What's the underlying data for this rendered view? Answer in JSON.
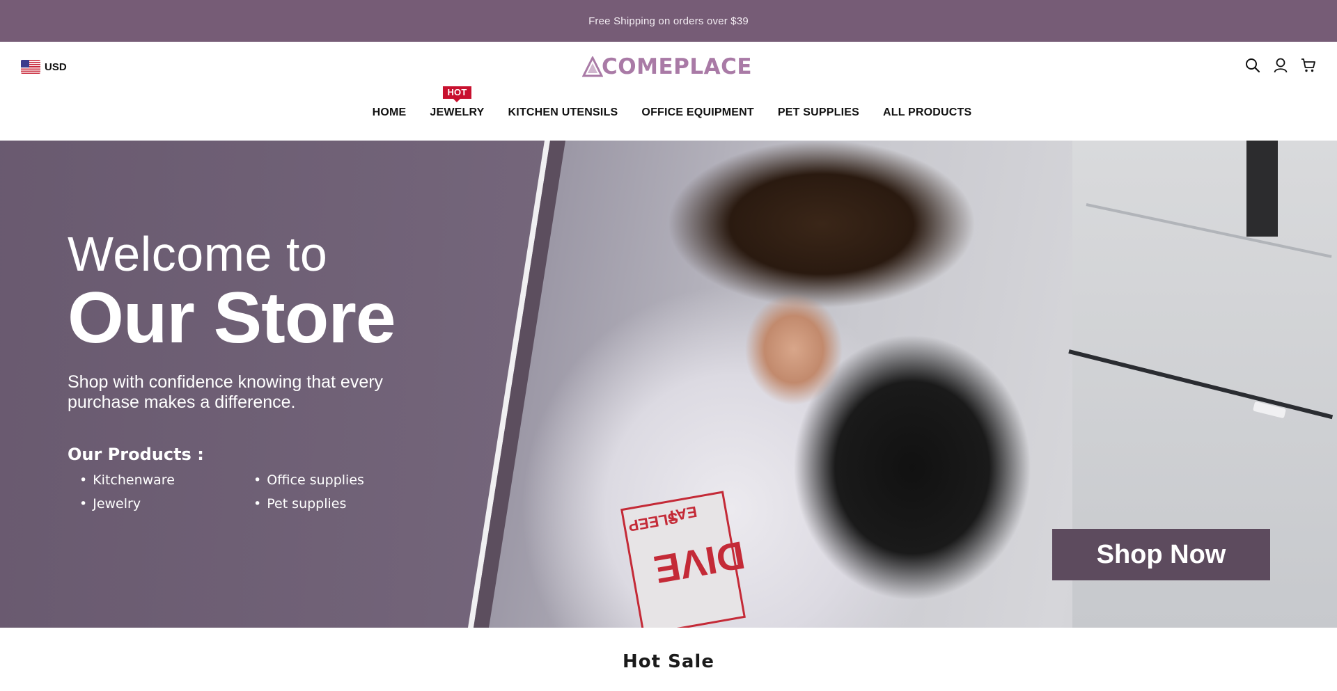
{
  "announcement": {
    "text": "Free Shipping on orders over $39"
  },
  "header": {
    "currency": {
      "flag_icon": "us-flag-icon",
      "code": "USD"
    },
    "logo": {
      "text": "COMEPLACE",
      "color": "#a97aa6"
    },
    "icons": [
      "search-icon",
      "account-icon",
      "cart-icon"
    ]
  },
  "nav": {
    "items": [
      {
        "label": "HOME"
      },
      {
        "label": "JEWELRY",
        "badge": "HOT"
      },
      {
        "label": "KITCHEN UTENSILS"
      },
      {
        "label": "OFFICE EQUIPMENT"
      },
      {
        "label": "PET SUPPLIES"
      },
      {
        "label": "ALL PRODUCTS"
      }
    ]
  },
  "hero": {
    "welcome": "Welcome to",
    "title": "Our Store",
    "tagline": "Shop with confidence knowing that every purchase makes a difference.",
    "products_title": "Our Products :",
    "products": [
      "Kitchenware",
      "Office supplies",
      "Jewelry",
      "Pet supplies"
    ],
    "cta": "Shop Now",
    "shirt_print_text": [
      "EAT",
      "SLEEP",
      "DIVE"
    ]
  },
  "section": {
    "title": "Hot Sale"
  },
  "colors": {
    "announcement_bg": "#765c76",
    "hot_badge": "#c8102e",
    "cta_bg": "#5d4b5e"
  }
}
